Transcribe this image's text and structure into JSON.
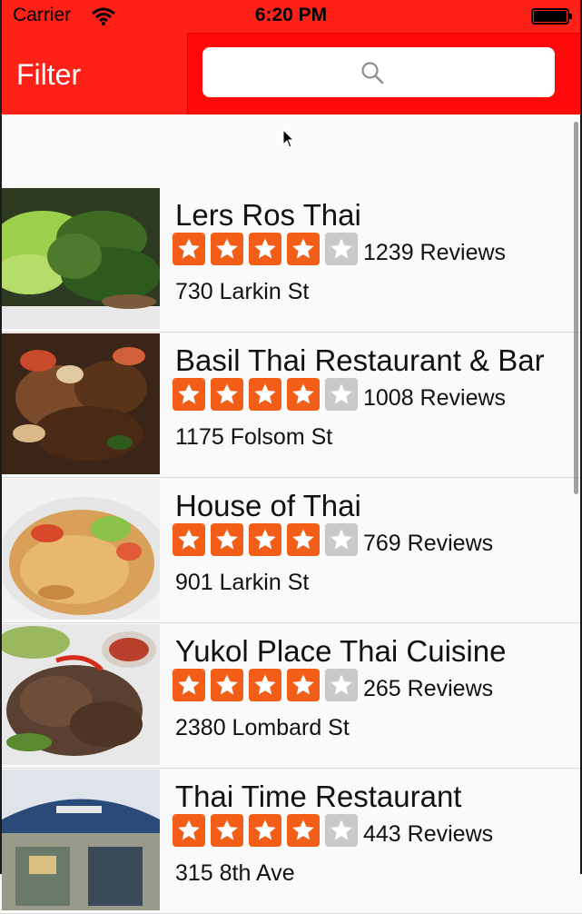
{
  "status": {
    "carrier": "Carrier",
    "time": "6:20 PM"
  },
  "nav": {
    "filter_label": "Filter",
    "search_placeholder": ""
  },
  "restaurants": [
    {
      "name": "Lers Ros Thai",
      "reviews": "1239 Reviews",
      "address": "730 Larkin St",
      "rating": 4,
      "photo": "herb-salad"
    },
    {
      "name": "Basil Thai Restaurant & Bar",
      "reviews": "1008 Reviews",
      "address": "1175 Folsom St",
      "rating": 4,
      "photo": "stir-fry"
    },
    {
      "name": "House of Thai",
      "reviews": "769 Reviews",
      "address": "901 Larkin St",
      "rating": 4,
      "photo": "noodles"
    },
    {
      "name": "Yukol Place Thai Cuisine",
      "reviews": "265 Reviews",
      "address": "2380 Lombard St",
      "rating": 4,
      "photo": "grilled-meat"
    },
    {
      "name": "Thai Time Restaurant",
      "reviews": "443 Reviews",
      "address": "315 8th Ave",
      "rating": 4,
      "photo": "storefront"
    }
  ],
  "colors": {
    "nav_red": "#ff2117",
    "star_orange": "#f25d18",
    "star_empty": "#c9c9c9"
  },
  "icons": [
    "wifi-icon",
    "battery-icon",
    "search-icon",
    "star-icon",
    "cursor-icon"
  ]
}
